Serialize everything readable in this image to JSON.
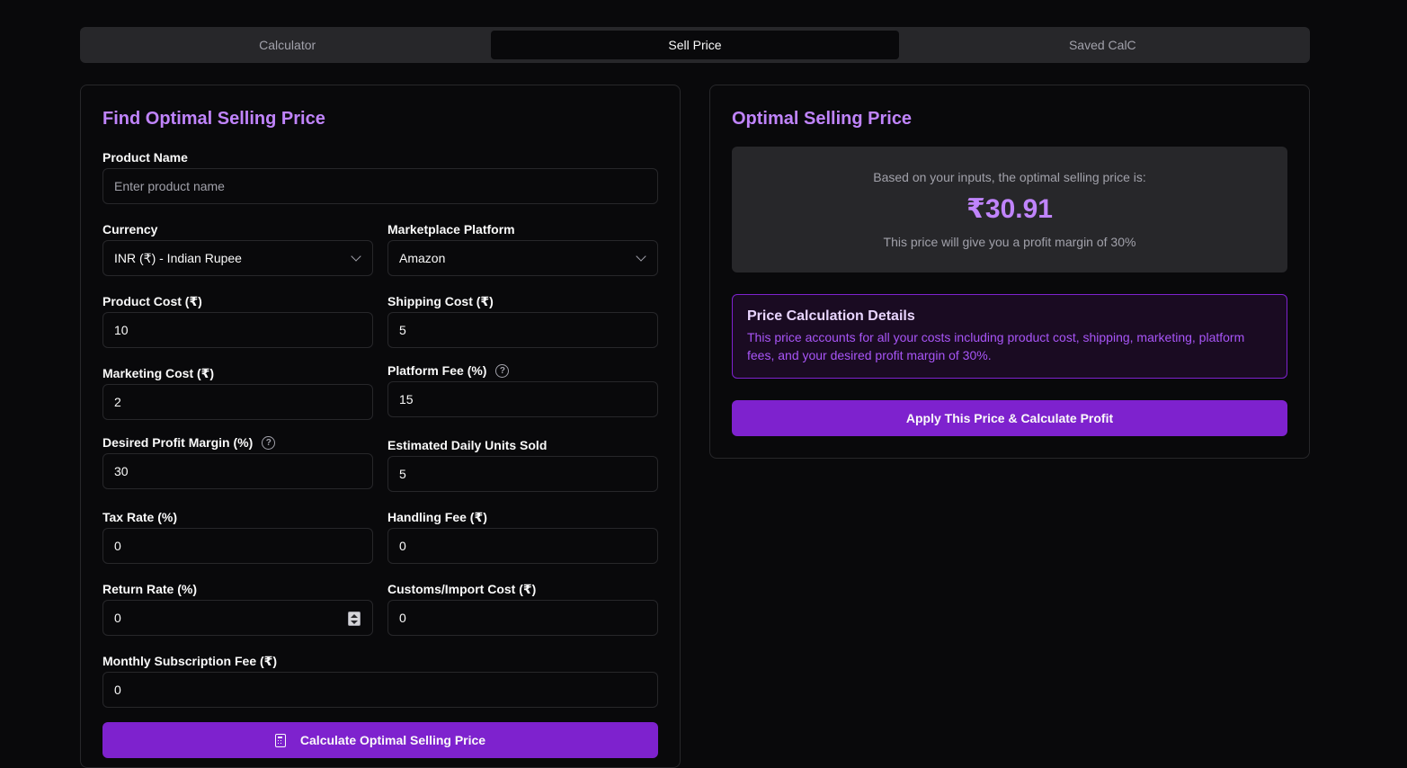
{
  "tabs": [
    {
      "label": "Calculator"
    },
    {
      "label": "Sell Price"
    },
    {
      "label": "Saved CalC"
    }
  ],
  "active_tab": "Sell Price",
  "form": {
    "title": "Find Optimal Selling Price",
    "product_name": {
      "label": "Product Name",
      "placeholder": "Enter product name",
      "value": ""
    },
    "currency": {
      "label": "Currency",
      "value": "INR (₹) - Indian Rupee"
    },
    "platform": {
      "label": "Marketplace Platform",
      "value": "Amazon"
    },
    "product_cost": {
      "label": "Product Cost (₹)",
      "value": "10"
    },
    "shipping_cost": {
      "label": "Shipping Cost (₹)",
      "value": "5"
    },
    "marketing_cost": {
      "label": "Marketing Cost (₹)",
      "value": "2"
    },
    "platform_fee": {
      "label": "Platform Fee (%)",
      "value": "15"
    },
    "profit_margin": {
      "label": "Desired Profit Margin (%)",
      "value": "30"
    },
    "daily_units": {
      "label": "Estimated Daily Units Sold",
      "value": "5"
    },
    "tax_rate": {
      "label": "Tax Rate (%)",
      "value": "0"
    },
    "handling_fee": {
      "label": "Handling Fee (₹)",
      "value": "0"
    },
    "return_rate": {
      "label": "Return Rate (%)",
      "value": "0"
    },
    "customs_cost": {
      "label": "Customs/Import Cost (₹)",
      "value": "0"
    },
    "subscription_fee": {
      "label": "Monthly Subscription Fee (₹)",
      "value": "0"
    },
    "calculate_label": "Calculate Optimal Selling Price"
  },
  "result": {
    "title": "Optimal Selling Price",
    "intro": "Based on your inputs, the optimal selling price is:",
    "price": "₹30.91",
    "note": "This price will give you a profit margin of 30%",
    "details_title": "Price Calculation Details",
    "details_text": "This price accounts for all your costs including product cost, shipping, marketing, platform fees, and your desired profit margin of 30%.",
    "apply_label": "Apply This Price & Calculate Profit"
  },
  "colors": {
    "accent": "#7e22ce",
    "accent_text": "#c084fc",
    "background": "#09090b"
  }
}
